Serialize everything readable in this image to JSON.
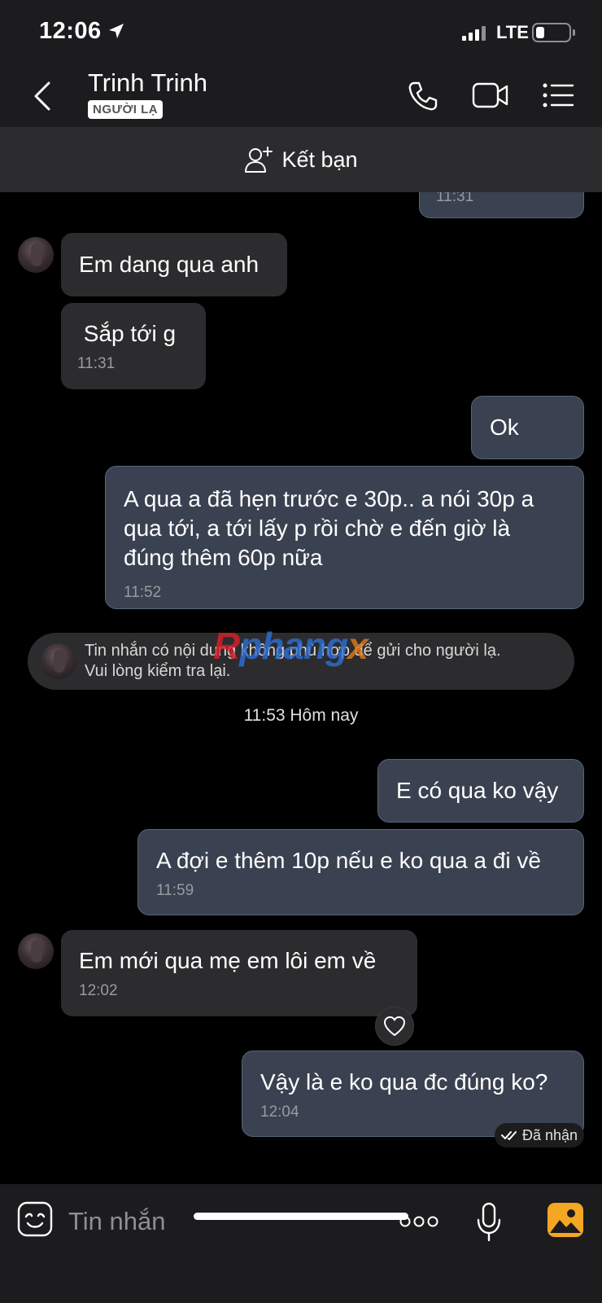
{
  "status_bar": {
    "time": "12:06",
    "network": "LTE",
    "battery_level": 0.2
  },
  "header": {
    "contact_name": "Trinh Trinh",
    "badge": "NGƯỜI LẠ",
    "icons": [
      "back-icon",
      "phone-icon",
      "video-camera-icon",
      "menu-icon"
    ]
  },
  "add_friend": {
    "label": "Kết bạn",
    "icon": "add-user-icon"
  },
  "messages": [
    {
      "direction": "out",
      "text": "",
      "time": "11:31"
    },
    {
      "direction": "in",
      "text": "Em dang qua anh",
      "time": ""
    },
    {
      "direction": "in",
      "text": " Sắp tới g",
      "time": "11:31"
    },
    {
      "direction": "out",
      "text": "Ok",
      "time": ""
    },
    {
      "direction": "out",
      "lines": [
        "A qua a đã hẹn trước e 30p.. a nói 30p a",
        "qua tới, a tới lấy p rồi chờ e đến giờ là",
        "đúng thêm 60p nữa"
      ],
      "time": "11:52"
    },
    {
      "direction": "out",
      "text": "E có qua ko vậy",
      "time": ""
    },
    {
      "direction": "out",
      "text": "A đợi e thêm 10p nếu e ko qua a đi về",
      "time": "11:59"
    },
    {
      "direction": "in",
      "text": "Em mới qua mẹ em lôi em về",
      "time": "12:02"
    },
    {
      "direction": "out",
      "text": "Vậy là e ko qua đc đúng ko?",
      "time": "12:04"
    }
  ],
  "system_notice": {
    "line1": "Tin nhắn có nội dung không phù hợp để gửi cho người lạ.",
    "line2": "Vui lòng kiểm tra lại."
  },
  "watermark": {
    "part1": "R",
    "part2": "phang",
    "part3": "x"
  },
  "date_separator": "11:53 Hôm nay",
  "delivery_status": "Đã nhận",
  "composer": {
    "placeholder": "Tin nhắn",
    "icons": [
      "sticker-icon",
      "more-icon",
      "microphone-icon",
      "image-icon"
    ]
  },
  "colors": {
    "incoming_bubble": "#2c2c2e",
    "outgoing_bubble": "#3a4150",
    "background": "#000000"
  }
}
